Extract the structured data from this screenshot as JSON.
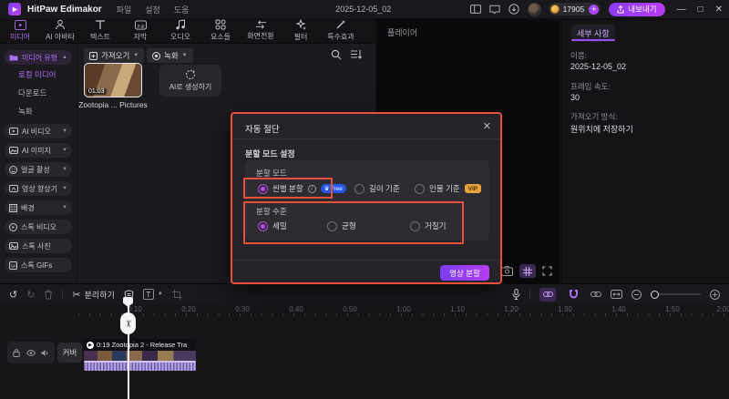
{
  "header": {
    "app_name": "HitPaw Edimakor",
    "menu": {
      "file": "파일",
      "settings": "설정",
      "help": "도움"
    },
    "project_title": "2025-12-05_02",
    "coins": "17905",
    "plus": "+",
    "export_label": "내보내기",
    "minimize": "—",
    "maximize": "□",
    "close": "✕"
  },
  "tabs": [
    {
      "label": "미디어"
    },
    {
      "label": "AI 아바타"
    },
    {
      "label": "텍스트"
    },
    {
      "label": "자막"
    },
    {
      "label": "오디오"
    },
    {
      "label": "요소들"
    },
    {
      "label": "화면전환"
    },
    {
      "label": "필터"
    },
    {
      "label": "특수효과"
    }
  ],
  "sidebar": {
    "media_type_header": "미디어 유형",
    "sub_items": [
      "로컬 미디어",
      "다운로드",
      "녹화"
    ],
    "groups": [
      "AI 비디오",
      "AI 이미지",
      "얼굴 활성",
      "영상 향상기",
      "배경"
    ],
    "stock_items": [
      "스톡 비디오",
      "스톡 사진",
      "스톡 GIFs"
    ]
  },
  "media_panel": {
    "import_label": "가져오기",
    "record_label": "녹화",
    "clip_duration": "01:03",
    "clip_name": "Zootopia ... Pictures",
    "ai_generate_label": "AI로 생성하기"
  },
  "player": {
    "title": "플레이어"
  },
  "details": {
    "tab_label": "세부 사항",
    "name_label": "이름:",
    "name_value": "2025-12-05_02",
    "framerate_label": "프레임 속도:",
    "framerate_value": "30",
    "import_method_label": "가져오기 방식:",
    "import_method_value": "원위치에 저장하기"
  },
  "dialog": {
    "title": "자동 절단",
    "close": "✕",
    "section_title": "분할 모드 설정",
    "mode_label": "분할 모드",
    "modes": [
      {
        "label": "씬별 분할",
        "badge": "Free",
        "selected": true
      },
      {
        "label": "길이 기준",
        "selected": false
      },
      {
        "label": "인물 기준",
        "badge": "VIP",
        "selected": false
      }
    ],
    "level_label": "분할 수준",
    "levels": [
      {
        "label": "세밀",
        "selected": true
      },
      {
        "label": "균형",
        "selected": false
      },
      {
        "label": "거칠기",
        "selected": false
      }
    ],
    "submit_label": "영상 분할"
  },
  "timeline": {
    "undo": "↺",
    "redo": "↻",
    "split_label": "분리하기",
    "cover_label": "커버",
    "clip_title": "0:19 Zootopia 2 - Release Tra",
    "ruler_labels": [
      "0:10",
      "0:20",
      "0:30",
      "0:40",
      "0:50",
      "1:00",
      "1:10",
      "1:20",
      "1:30",
      "1:40",
      "1:50",
      "2:00"
    ]
  },
  "colors": {
    "accent": "#a158f0",
    "annotation": "#e8503a",
    "free_badge": "#2457e6",
    "vip_badge": "#e8a23c"
  }
}
